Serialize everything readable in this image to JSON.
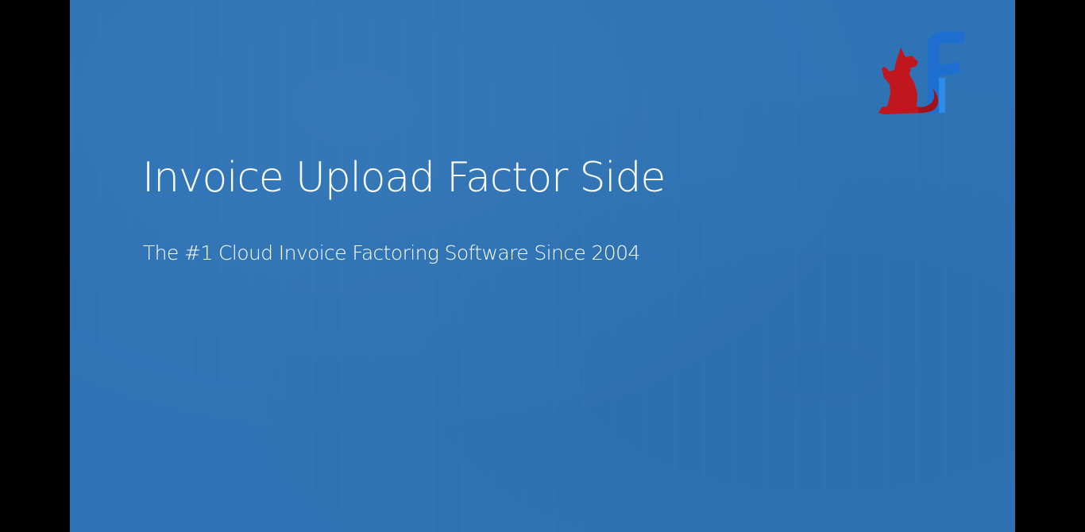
{
  "slide": {
    "title": "Invoice Upload Factor Side",
    "subtitle": "The #1 Cloud Invoice Factoring Software Since 2004",
    "background_color": "#2e73b5",
    "letterbox_color": "#000000"
  },
  "logo": {
    "icon": "fox-f-logo-icon",
    "fox_color": "#c0161d",
    "letter_color": "#1e6fd0"
  }
}
